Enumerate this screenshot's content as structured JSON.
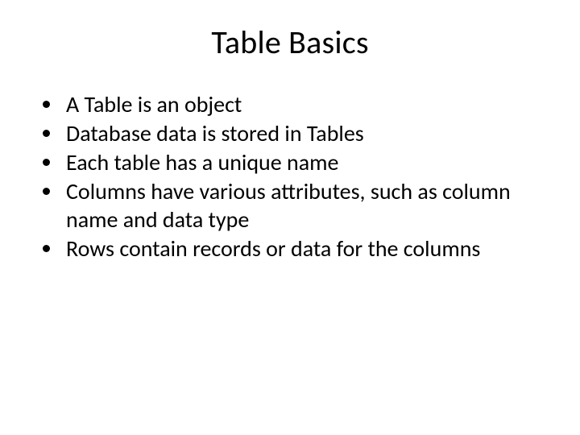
{
  "title": "Table Basics",
  "bullets": [
    "A Table is an object",
    "Database data is stored in Tables",
    "Each table has a unique name",
    "Columns have various attributes, such as column name and data type",
    "Rows contain records or data for the columns"
  ]
}
